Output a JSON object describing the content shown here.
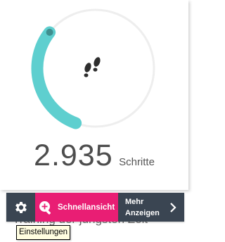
{
  "activity": {
    "steps_value": "2.935",
    "steps_unit": "Schritte",
    "progress_fraction": 0.3,
    "ring_color": "#5ecfcf",
    "track_color": "#eeeeee"
  },
  "background_text": "Training der jüngsten Zeit",
  "toolbar": {
    "settings_icon": "gear-icon",
    "quick_view_icon": "magnifier-plus-icon",
    "quick_view_label": "Schnellansicht",
    "more_label_line1": "Mehr",
    "more_label_line2": "Anzeigen",
    "more_icon": "chevron-right-icon",
    "quick_view_color": "#e91e74",
    "bar_color": "#3a4552"
  },
  "tooltip": {
    "text": "Einstellungen"
  }
}
